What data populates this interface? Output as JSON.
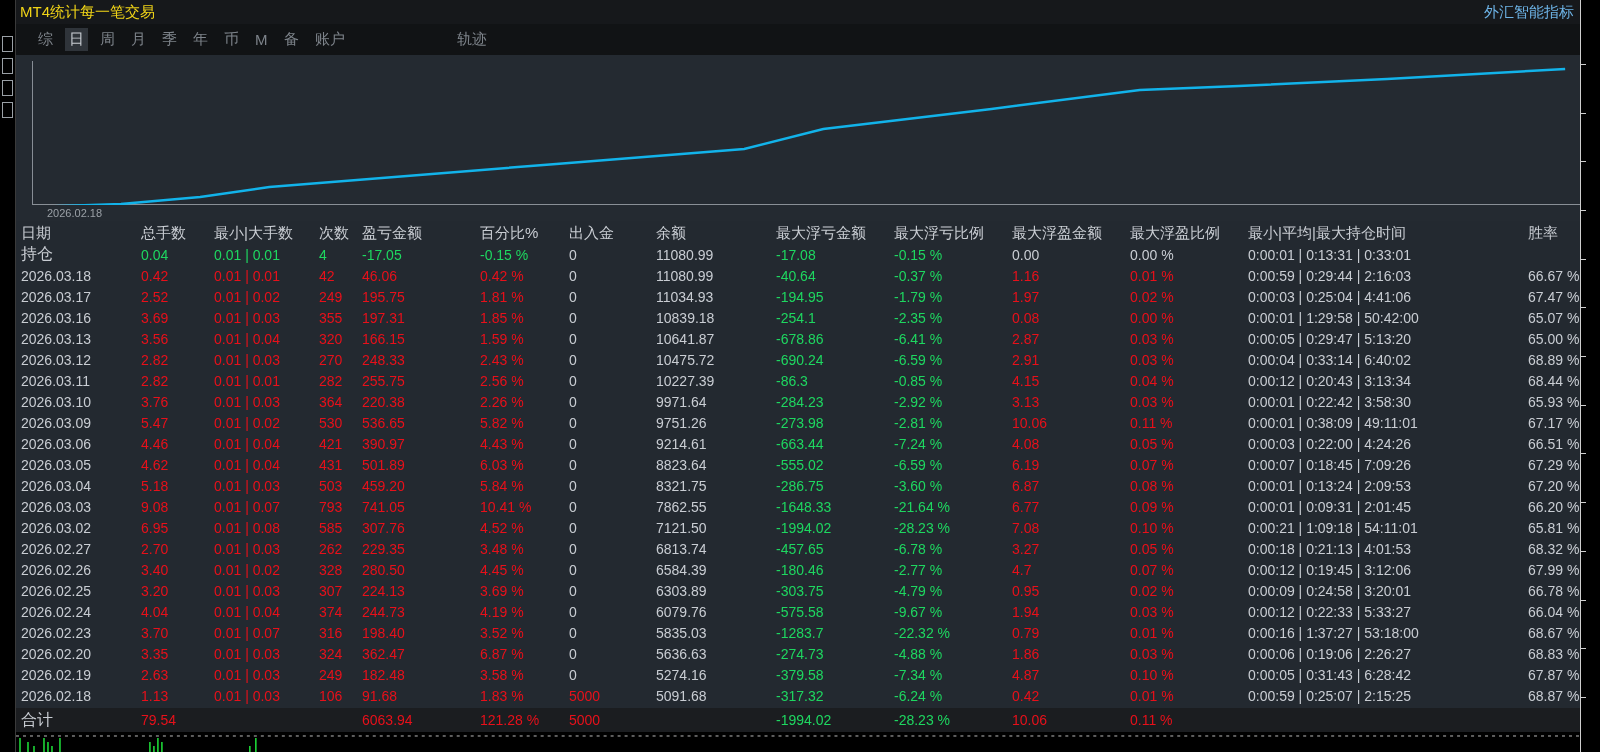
{
  "window": {
    "title": "MT4统计每一笔交易",
    "brand": "外汇智能指标"
  },
  "tabs": [
    {
      "label": "综",
      "selected": false
    },
    {
      "label": "日",
      "selected": true
    },
    {
      "label": "周",
      "selected": false
    },
    {
      "label": "月",
      "selected": false
    },
    {
      "label": "季",
      "selected": false
    },
    {
      "label": "年",
      "selected": false
    },
    {
      "label": "币",
      "selected": false
    },
    {
      "label": "M",
      "selected": false
    },
    {
      "label": "备",
      "selected": false
    },
    {
      "label": "账户",
      "selected": false
    }
  ],
  "trail_tab": {
    "label": "轨迹",
    "selected": false
  },
  "chart": {
    "start_label": "2026.02.18"
  },
  "table": {
    "columns": [
      "日期",
      "总手数",
      "最小|大手数",
      "次数",
      "盈亏金额",
      "百分比%",
      "出入金",
      "余额",
      "最大浮亏金额",
      "最大浮亏比例",
      "最大浮盈金额",
      "最大浮盈比例",
      "最小|平均|最大持仓时间",
      "胜率"
    ],
    "rows": [
      {
        "kind": "position",
        "cells": [
          {
            "text": "持仓",
            "color": "#c9cdd3"
          },
          {
            "text": "0.04",
            "color": "#1ed760"
          },
          {
            "text": "0.01 | 0.01",
            "color": "#1ed760"
          },
          {
            "text": "4",
            "color": "#1ed760"
          },
          {
            "text": "-17.05",
            "color": "#1ed760"
          },
          {
            "text": "-0.15 %",
            "color": "#1ed760"
          },
          {
            "text": "0",
            "color": "#c9cdd3"
          },
          {
            "text": "11080.99",
            "color": "#c9cdd3"
          },
          {
            "text": "-17.08",
            "color": "#1ed760"
          },
          {
            "text": "-0.15 %",
            "color": "#1ed760"
          },
          {
            "text": "0.00",
            "color": "#c9cdd3"
          },
          {
            "text": "0.00 %",
            "color": "#c9cdd3"
          },
          {
            "text": "0:00:01 | 0:13:31 | 0:33:01",
            "color": "#c9cdd3"
          },
          null
        ]
      },
      {
        "kind": "day",
        "cells": [
          {
            "text": "2026.03.18",
            "color": "#c9cdd3"
          },
          {
            "text": "0.42",
            "color": "#e8101a"
          },
          {
            "text": "0.01 | 0.01",
            "color": "#e8101a"
          },
          {
            "text": "42",
            "color": "#e8101a"
          },
          {
            "text": "46.06",
            "color": "#e8101a"
          },
          {
            "text": "0.42 %",
            "color": "#e8101a"
          },
          {
            "text": "0",
            "color": "#c9cdd3"
          },
          {
            "text": "11080.99",
            "color": "#c9cdd3"
          },
          {
            "text": "-40.64",
            "color": "#1ed760"
          },
          {
            "text": "-0.37 %",
            "color": "#1ed760"
          },
          {
            "text": "1.16",
            "color": "#e8101a"
          },
          {
            "text": "0.01 %",
            "color": "#e8101a"
          },
          {
            "text": "0:00:59 | 0:29:44 | 2:16:03",
            "color": "#c9cdd3"
          },
          {
            "text": "66.67 %",
            "color": "#c9cdd3"
          }
        ]
      },
      {
        "kind": "day",
        "cells": [
          {
            "text": "2026.03.17",
            "color": "#c9cdd3"
          },
          {
            "text": "2.52",
            "color": "#e8101a"
          },
          {
            "text": "0.01 | 0.02",
            "color": "#e8101a"
          },
          {
            "text": "249",
            "color": "#e8101a"
          },
          {
            "text": "195.75",
            "color": "#e8101a"
          },
          {
            "text": "1.81 %",
            "color": "#e8101a"
          },
          {
            "text": "0",
            "color": "#c9cdd3"
          },
          {
            "text": "11034.93",
            "color": "#c9cdd3"
          },
          {
            "text": "-194.95",
            "color": "#1ed760"
          },
          {
            "text": "-1.79 %",
            "color": "#1ed760"
          },
          {
            "text": "1.97",
            "color": "#e8101a"
          },
          {
            "text": "0.02 %",
            "color": "#e8101a"
          },
          {
            "text": "0:00:03 | 0:25:04 | 4:41:06",
            "color": "#c9cdd3"
          },
          {
            "text": "67.47 %",
            "color": "#c9cdd3"
          }
        ]
      },
      {
        "kind": "day",
        "cells": [
          {
            "text": "2026.03.16",
            "color": "#c9cdd3"
          },
          {
            "text": "3.69",
            "color": "#e8101a"
          },
          {
            "text": "0.01 | 0.03",
            "color": "#e8101a"
          },
          {
            "text": "355",
            "color": "#e8101a"
          },
          {
            "text": "197.31",
            "color": "#e8101a"
          },
          {
            "text": "1.85 %",
            "color": "#e8101a"
          },
          {
            "text": "0",
            "color": "#c9cdd3"
          },
          {
            "text": "10839.18",
            "color": "#c9cdd3"
          },
          {
            "text": "-254.1",
            "color": "#1ed760"
          },
          {
            "text": "-2.35 %",
            "color": "#1ed760"
          },
          {
            "text": "0.08",
            "color": "#e8101a"
          },
          {
            "text": "0.00 %",
            "color": "#e8101a"
          },
          {
            "text": "0:00:01 | 1:29:58 | 50:42:00",
            "color": "#c9cdd3"
          },
          {
            "text": "65.07 %",
            "color": "#c9cdd3"
          }
        ]
      },
      {
        "kind": "day",
        "cells": [
          {
            "text": "2026.03.13",
            "color": "#c9cdd3"
          },
          {
            "text": "3.56",
            "color": "#e8101a"
          },
          {
            "text": "0.01 | 0.04",
            "color": "#e8101a"
          },
          {
            "text": "320",
            "color": "#e8101a"
          },
          {
            "text": "166.15",
            "color": "#e8101a"
          },
          {
            "text": "1.59 %",
            "color": "#e8101a"
          },
          {
            "text": "0",
            "color": "#c9cdd3"
          },
          {
            "text": "10641.87",
            "color": "#c9cdd3"
          },
          {
            "text": "-678.86",
            "color": "#1ed760"
          },
          {
            "text": "-6.41 %",
            "color": "#1ed760"
          },
          {
            "text": "2.87",
            "color": "#e8101a"
          },
          {
            "text": "0.03 %",
            "color": "#e8101a"
          },
          {
            "text": "0:00:05 | 0:29:47 | 5:13:20",
            "color": "#c9cdd3"
          },
          {
            "text": "65.00 %",
            "color": "#c9cdd3"
          }
        ]
      },
      {
        "kind": "day",
        "cells": [
          {
            "text": "2026.03.12",
            "color": "#c9cdd3"
          },
          {
            "text": "2.82",
            "color": "#e8101a"
          },
          {
            "text": "0.01 | 0.03",
            "color": "#e8101a"
          },
          {
            "text": "270",
            "color": "#e8101a"
          },
          {
            "text": "248.33",
            "color": "#e8101a"
          },
          {
            "text": "2.43 %",
            "color": "#e8101a"
          },
          {
            "text": "0",
            "color": "#c9cdd3"
          },
          {
            "text": "10475.72",
            "color": "#c9cdd3"
          },
          {
            "text": "-690.24",
            "color": "#1ed760"
          },
          {
            "text": "-6.59 %",
            "color": "#1ed760"
          },
          {
            "text": "2.91",
            "color": "#e8101a"
          },
          {
            "text": "0.03 %",
            "color": "#e8101a"
          },
          {
            "text": "0:00:04 | 0:33:14 | 6:40:02",
            "color": "#c9cdd3"
          },
          {
            "text": "68.89 %",
            "color": "#c9cdd3"
          }
        ]
      },
      {
        "kind": "day",
        "cells": [
          {
            "text": "2026.03.11",
            "color": "#c9cdd3"
          },
          {
            "text": "2.82",
            "color": "#e8101a"
          },
          {
            "text": "0.01 | 0.01",
            "color": "#e8101a"
          },
          {
            "text": "282",
            "color": "#e8101a"
          },
          {
            "text": "255.75",
            "color": "#e8101a"
          },
          {
            "text": "2.56 %",
            "color": "#e8101a"
          },
          {
            "text": "0",
            "color": "#c9cdd3"
          },
          {
            "text": "10227.39",
            "color": "#c9cdd3"
          },
          {
            "text": "-86.3",
            "color": "#1ed760"
          },
          {
            "text": "-0.85 %",
            "color": "#1ed760"
          },
          {
            "text": "4.15",
            "color": "#e8101a"
          },
          {
            "text": "0.04 %",
            "color": "#e8101a"
          },
          {
            "text": "0:00:12 | 0:20:43 | 3:13:34",
            "color": "#c9cdd3"
          },
          {
            "text": "68.44 %",
            "color": "#c9cdd3"
          }
        ]
      },
      {
        "kind": "day",
        "cells": [
          {
            "text": "2026.03.10",
            "color": "#c9cdd3"
          },
          {
            "text": "3.76",
            "color": "#e8101a"
          },
          {
            "text": "0.01 | 0.03",
            "color": "#e8101a"
          },
          {
            "text": "364",
            "color": "#e8101a"
          },
          {
            "text": "220.38",
            "color": "#e8101a"
          },
          {
            "text": "2.26 %",
            "color": "#e8101a"
          },
          {
            "text": "0",
            "color": "#c9cdd3"
          },
          {
            "text": "9971.64",
            "color": "#c9cdd3"
          },
          {
            "text": "-284.23",
            "color": "#1ed760"
          },
          {
            "text": "-2.92 %",
            "color": "#1ed760"
          },
          {
            "text": "3.13",
            "color": "#e8101a"
          },
          {
            "text": "0.03 %",
            "color": "#e8101a"
          },
          {
            "text": "0:00:01 | 0:22:42 | 3:58:30",
            "color": "#c9cdd3"
          },
          {
            "text": "65.93 %",
            "color": "#c9cdd3"
          }
        ]
      },
      {
        "kind": "day",
        "cells": [
          {
            "text": "2026.03.09",
            "color": "#c9cdd3"
          },
          {
            "text": "5.47",
            "color": "#e8101a"
          },
          {
            "text": "0.01 | 0.02",
            "color": "#e8101a"
          },
          {
            "text": "530",
            "color": "#e8101a"
          },
          {
            "text": "536.65",
            "color": "#e8101a"
          },
          {
            "text": "5.82 %",
            "color": "#e8101a"
          },
          {
            "text": "0",
            "color": "#c9cdd3"
          },
          {
            "text": "9751.26",
            "color": "#c9cdd3"
          },
          {
            "text": "-273.98",
            "color": "#1ed760"
          },
          {
            "text": "-2.81 %",
            "color": "#1ed760"
          },
          {
            "text": "10.06",
            "color": "#e8101a"
          },
          {
            "text": "0.11 %",
            "color": "#e8101a"
          },
          {
            "text": "0:00:01 | 0:38:09 | 49:11:01",
            "color": "#c9cdd3"
          },
          {
            "text": "67.17 %",
            "color": "#c9cdd3"
          }
        ]
      },
      {
        "kind": "day",
        "cells": [
          {
            "text": "2026.03.06",
            "color": "#c9cdd3"
          },
          {
            "text": "4.46",
            "color": "#e8101a"
          },
          {
            "text": "0.01 | 0.04",
            "color": "#e8101a"
          },
          {
            "text": "421",
            "color": "#e8101a"
          },
          {
            "text": "390.97",
            "color": "#e8101a"
          },
          {
            "text": "4.43 %",
            "color": "#e8101a"
          },
          {
            "text": "0",
            "color": "#c9cdd3"
          },
          {
            "text": "9214.61",
            "color": "#c9cdd3"
          },
          {
            "text": "-663.44",
            "color": "#1ed760"
          },
          {
            "text": "-7.24 %",
            "color": "#1ed760"
          },
          {
            "text": "4.08",
            "color": "#e8101a"
          },
          {
            "text": "0.05 %",
            "color": "#e8101a"
          },
          {
            "text": "0:00:03 | 0:22:00 | 4:24:26",
            "color": "#c9cdd3"
          },
          {
            "text": "66.51 %",
            "color": "#c9cdd3"
          }
        ]
      },
      {
        "kind": "day",
        "cells": [
          {
            "text": "2026.03.05",
            "color": "#c9cdd3"
          },
          {
            "text": "4.62",
            "color": "#e8101a"
          },
          {
            "text": "0.01 | 0.04",
            "color": "#e8101a"
          },
          {
            "text": "431",
            "color": "#e8101a"
          },
          {
            "text": "501.89",
            "color": "#e8101a"
          },
          {
            "text": "6.03 %",
            "color": "#e8101a"
          },
          {
            "text": "0",
            "color": "#c9cdd3"
          },
          {
            "text": "8823.64",
            "color": "#c9cdd3"
          },
          {
            "text": "-555.02",
            "color": "#1ed760"
          },
          {
            "text": "-6.59 %",
            "color": "#1ed760"
          },
          {
            "text": "6.19",
            "color": "#e8101a"
          },
          {
            "text": "0.07 %",
            "color": "#e8101a"
          },
          {
            "text": "0:00:07 | 0:18:45 | 7:09:26",
            "color": "#c9cdd3"
          },
          {
            "text": "67.29 %",
            "color": "#c9cdd3"
          }
        ]
      },
      {
        "kind": "day",
        "cells": [
          {
            "text": "2026.03.04",
            "color": "#c9cdd3"
          },
          {
            "text": "5.18",
            "color": "#e8101a"
          },
          {
            "text": "0.01 | 0.03",
            "color": "#e8101a"
          },
          {
            "text": "503",
            "color": "#e8101a"
          },
          {
            "text": "459.20",
            "color": "#e8101a"
          },
          {
            "text": "5.84 %",
            "color": "#e8101a"
          },
          {
            "text": "0",
            "color": "#c9cdd3"
          },
          {
            "text": "8321.75",
            "color": "#c9cdd3"
          },
          {
            "text": "-286.75",
            "color": "#1ed760"
          },
          {
            "text": "-3.60 %",
            "color": "#1ed760"
          },
          {
            "text": "6.87",
            "color": "#e8101a"
          },
          {
            "text": "0.08 %",
            "color": "#e8101a"
          },
          {
            "text": "0:00:01 | 0:13:24 | 2:09:53",
            "color": "#c9cdd3"
          },
          {
            "text": "67.20 %",
            "color": "#c9cdd3"
          }
        ]
      },
      {
        "kind": "day",
        "cells": [
          {
            "text": "2026.03.03",
            "color": "#c9cdd3"
          },
          {
            "text": "9.08",
            "color": "#e8101a"
          },
          {
            "text": "0.01 | 0.07",
            "color": "#e8101a"
          },
          {
            "text": "793",
            "color": "#e8101a"
          },
          {
            "text": "741.05",
            "color": "#e8101a"
          },
          {
            "text": "10.41 %",
            "color": "#e8101a"
          },
          {
            "text": "0",
            "color": "#c9cdd3"
          },
          {
            "text": "7862.55",
            "color": "#c9cdd3"
          },
          {
            "text": "-1648.33",
            "color": "#1ed760"
          },
          {
            "text": "-21.64 %",
            "color": "#1ed760"
          },
          {
            "text": "6.77",
            "color": "#e8101a"
          },
          {
            "text": "0.09 %",
            "color": "#e8101a"
          },
          {
            "text": "0:00:01 | 0:09:31 | 2:01:45",
            "color": "#c9cdd3"
          },
          {
            "text": "66.20 %",
            "color": "#c9cdd3"
          }
        ]
      },
      {
        "kind": "day",
        "cells": [
          {
            "text": "2026.03.02",
            "color": "#c9cdd3"
          },
          {
            "text": "6.95",
            "color": "#e8101a"
          },
          {
            "text": "0.01 | 0.08",
            "color": "#e8101a"
          },
          {
            "text": "585",
            "color": "#e8101a"
          },
          {
            "text": "307.76",
            "color": "#e8101a"
          },
          {
            "text": "4.52 %",
            "color": "#e8101a"
          },
          {
            "text": "0",
            "color": "#c9cdd3"
          },
          {
            "text": "7121.50",
            "color": "#c9cdd3"
          },
          {
            "text": "-1994.02",
            "color": "#1ed760"
          },
          {
            "text": "-28.23 %",
            "color": "#1ed760"
          },
          {
            "text": "7.08",
            "color": "#e8101a"
          },
          {
            "text": "0.10 %",
            "color": "#e8101a"
          },
          {
            "text": "0:00:21 | 1:09:18 | 54:11:01",
            "color": "#c9cdd3"
          },
          {
            "text": "65.81 %",
            "color": "#c9cdd3"
          }
        ]
      },
      {
        "kind": "day",
        "cells": [
          {
            "text": "2026.02.27",
            "color": "#c9cdd3"
          },
          {
            "text": "2.70",
            "color": "#e8101a"
          },
          {
            "text": "0.01 | 0.03",
            "color": "#e8101a"
          },
          {
            "text": "262",
            "color": "#e8101a"
          },
          {
            "text": "229.35",
            "color": "#e8101a"
          },
          {
            "text": "3.48 %",
            "color": "#e8101a"
          },
          {
            "text": "0",
            "color": "#c9cdd3"
          },
          {
            "text": "6813.74",
            "color": "#c9cdd3"
          },
          {
            "text": "-457.65",
            "color": "#1ed760"
          },
          {
            "text": "-6.78 %",
            "color": "#1ed760"
          },
          {
            "text": "3.27",
            "color": "#e8101a"
          },
          {
            "text": "0.05 %",
            "color": "#e8101a"
          },
          {
            "text": "0:00:18 | 0:21:13 | 4:01:53",
            "color": "#c9cdd3"
          },
          {
            "text": "68.32 %",
            "color": "#c9cdd3"
          }
        ]
      },
      {
        "kind": "day",
        "cells": [
          {
            "text": "2026.02.26",
            "color": "#c9cdd3"
          },
          {
            "text": "3.40",
            "color": "#e8101a"
          },
          {
            "text": "0.01 | 0.02",
            "color": "#e8101a"
          },
          {
            "text": "328",
            "color": "#e8101a"
          },
          {
            "text": "280.50",
            "color": "#e8101a"
          },
          {
            "text": "4.45 %",
            "color": "#e8101a"
          },
          {
            "text": "0",
            "color": "#c9cdd3"
          },
          {
            "text": "6584.39",
            "color": "#c9cdd3"
          },
          {
            "text": "-180.46",
            "color": "#1ed760"
          },
          {
            "text": "-2.77 %",
            "color": "#1ed760"
          },
          {
            "text": "4.7",
            "color": "#e8101a"
          },
          {
            "text": "0.07 %",
            "color": "#e8101a"
          },
          {
            "text": "0:00:12 | 0:19:45 | 3:12:06",
            "color": "#c9cdd3"
          },
          {
            "text": "67.99 %",
            "color": "#c9cdd3"
          }
        ]
      },
      {
        "kind": "day",
        "cells": [
          {
            "text": "2026.02.25",
            "color": "#c9cdd3"
          },
          {
            "text": "3.20",
            "color": "#e8101a"
          },
          {
            "text": "0.01 | 0.03",
            "color": "#e8101a"
          },
          {
            "text": "307",
            "color": "#e8101a"
          },
          {
            "text": "224.13",
            "color": "#e8101a"
          },
          {
            "text": "3.69 %",
            "color": "#e8101a"
          },
          {
            "text": "0",
            "color": "#c9cdd3"
          },
          {
            "text": "6303.89",
            "color": "#c9cdd3"
          },
          {
            "text": "-303.75",
            "color": "#1ed760"
          },
          {
            "text": "-4.79 %",
            "color": "#1ed760"
          },
          {
            "text": "0.95",
            "color": "#e8101a"
          },
          {
            "text": "0.02 %",
            "color": "#e8101a"
          },
          {
            "text": "0:00:09 | 0:24:58 | 3:20:01",
            "color": "#c9cdd3"
          },
          {
            "text": "66.78 %",
            "color": "#c9cdd3"
          }
        ]
      },
      {
        "kind": "day",
        "cells": [
          {
            "text": "2026.02.24",
            "color": "#c9cdd3"
          },
          {
            "text": "4.04",
            "color": "#e8101a"
          },
          {
            "text": "0.01 | 0.04",
            "color": "#e8101a"
          },
          {
            "text": "374",
            "color": "#e8101a"
          },
          {
            "text": "244.73",
            "color": "#e8101a"
          },
          {
            "text": "4.19 %",
            "color": "#e8101a"
          },
          {
            "text": "0",
            "color": "#c9cdd3"
          },
          {
            "text": "6079.76",
            "color": "#c9cdd3"
          },
          {
            "text": "-575.58",
            "color": "#1ed760"
          },
          {
            "text": "-9.67 %",
            "color": "#1ed760"
          },
          {
            "text": "1.94",
            "color": "#e8101a"
          },
          {
            "text": "0.03 %",
            "color": "#e8101a"
          },
          {
            "text": "0:00:12 | 0:22:33 | 5:33:27",
            "color": "#c9cdd3"
          },
          {
            "text": "66.04 %",
            "color": "#c9cdd3"
          }
        ]
      },
      {
        "kind": "day",
        "cells": [
          {
            "text": "2026.02.23",
            "color": "#c9cdd3"
          },
          {
            "text": "3.70",
            "color": "#e8101a"
          },
          {
            "text": "0.01 | 0.07",
            "color": "#e8101a"
          },
          {
            "text": "316",
            "color": "#e8101a"
          },
          {
            "text": "198.40",
            "color": "#e8101a"
          },
          {
            "text": "3.52 %",
            "color": "#e8101a"
          },
          {
            "text": "0",
            "color": "#c9cdd3"
          },
          {
            "text": "5835.03",
            "color": "#c9cdd3"
          },
          {
            "text": "-1283.7",
            "color": "#1ed760"
          },
          {
            "text": "-22.32 %",
            "color": "#1ed760"
          },
          {
            "text": "0.79",
            "color": "#e8101a"
          },
          {
            "text": "0.01 %",
            "color": "#e8101a"
          },
          {
            "text": "0:00:16 | 1:37:27 | 53:18:00",
            "color": "#c9cdd3"
          },
          {
            "text": "68.67 %",
            "color": "#c9cdd3"
          }
        ]
      },
      {
        "kind": "day",
        "cells": [
          {
            "text": "2026.02.20",
            "color": "#c9cdd3"
          },
          {
            "text": "3.35",
            "color": "#e8101a"
          },
          {
            "text": "0.01 | 0.03",
            "color": "#e8101a"
          },
          {
            "text": "324",
            "color": "#e8101a"
          },
          {
            "text": "362.47",
            "color": "#e8101a"
          },
          {
            "text": "6.87 %",
            "color": "#e8101a"
          },
          {
            "text": "0",
            "color": "#c9cdd3"
          },
          {
            "text": "5636.63",
            "color": "#c9cdd3"
          },
          {
            "text": "-274.73",
            "color": "#1ed760"
          },
          {
            "text": "-4.88 %",
            "color": "#1ed760"
          },
          {
            "text": "1.86",
            "color": "#e8101a"
          },
          {
            "text": "0.03 %",
            "color": "#e8101a"
          },
          {
            "text": "0:00:06 | 0:19:06 | 2:26:27",
            "color": "#c9cdd3"
          },
          {
            "text": "68.83 %",
            "color": "#c9cdd3"
          }
        ]
      },
      {
        "kind": "day",
        "cells": [
          {
            "text": "2026.02.19",
            "color": "#c9cdd3"
          },
          {
            "text": "2.63",
            "color": "#e8101a"
          },
          {
            "text": "0.01 | 0.03",
            "color": "#e8101a"
          },
          {
            "text": "249",
            "color": "#e8101a"
          },
          {
            "text": "182.48",
            "color": "#e8101a"
          },
          {
            "text": "3.58 %",
            "color": "#e8101a"
          },
          {
            "text": "0",
            "color": "#c9cdd3"
          },
          {
            "text": "5274.16",
            "color": "#c9cdd3"
          },
          {
            "text": "-379.58",
            "color": "#1ed760"
          },
          {
            "text": "-7.34 %",
            "color": "#1ed760"
          },
          {
            "text": "4.87",
            "color": "#e8101a"
          },
          {
            "text": "0.10 %",
            "color": "#e8101a"
          },
          {
            "text": "0:00:05 | 0:31:43 | 6:28:42",
            "color": "#c9cdd3"
          },
          {
            "text": "67.87 %",
            "color": "#c9cdd3"
          }
        ]
      },
      {
        "kind": "day",
        "cells": [
          {
            "text": "2026.02.18",
            "color": "#c9cdd3"
          },
          {
            "text": "1.13",
            "color": "#e8101a"
          },
          {
            "text": "0.01 | 0.03",
            "color": "#e8101a"
          },
          {
            "text": "106",
            "color": "#e8101a"
          },
          {
            "text": "91.68",
            "color": "#e8101a"
          },
          {
            "text": "1.83 %",
            "color": "#e8101a"
          },
          {
            "text": "5000",
            "color": "#e8101a"
          },
          {
            "text": "5091.68",
            "color": "#c9cdd3"
          },
          {
            "text": "-317.32",
            "color": "#1ed760"
          },
          {
            "text": "-6.24 %",
            "color": "#1ed760"
          },
          {
            "text": "0.42",
            "color": "#e8101a"
          },
          {
            "text": "0.01 %",
            "color": "#e8101a"
          },
          {
            "text": "0:00:59 | 0:25:07 | 2:15:25",
            "color": "#c9cdd3"
          },
          {
            "text": "68.87 %",
            "color": "#c9cdd3"
          }
        ]
      },
      {
        "kind": "total",
        "cells": [
          {
            "text": "合计",
            "color": "#c9cdd3"
          },
          {
            "text": "79.54",
            "color": "#e8101a"
          },
          null,
          null,
          {
            "text": "6063.94",
            "color": "#e8101a"
          },
          {
            "text": "121.28 %",
            "color": "#e8101a"
          },
          {
            "text": "5000",
            "color": "#e8101a"
          },
          null,
          {
            "text": "-1994.02",
            "color": "#1ed760"
          },
          {
            "text": "-28.23 %",
            "color": "#1ed760"
          },
          {
            "text": "10.06",
            "color": "#e8101a"
          },
          {
            "text": "0.11 %",
            "color": "#e8101a"
          },
          null,
          null
        ]
      }
    ]
  }
}
